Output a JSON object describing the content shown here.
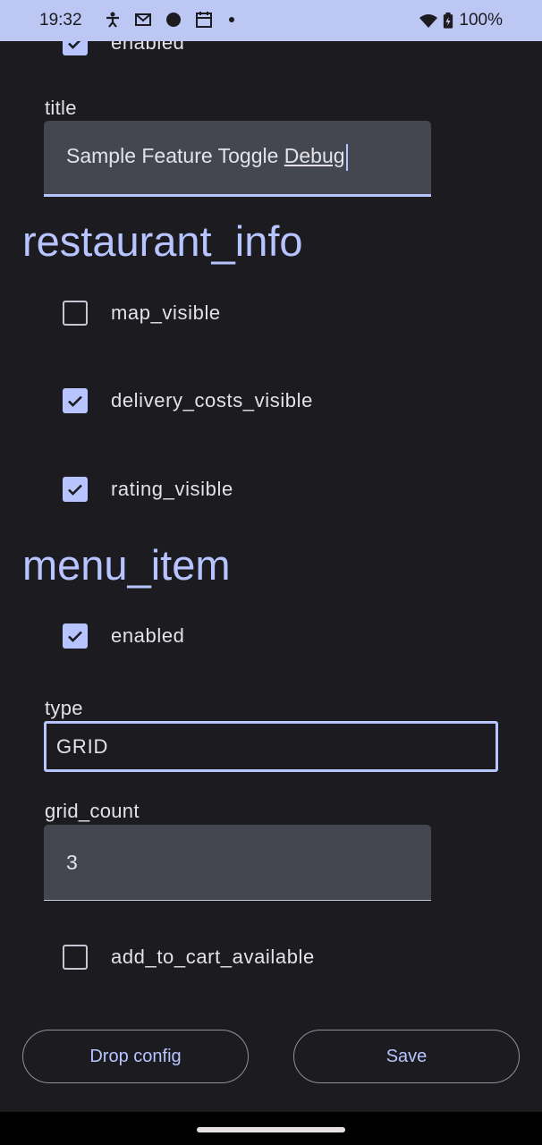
{
  "status_bar": {
    "time": "19:32",
    "battery": "100%",
    "left_icons": [
      "accessibility-icon",
      "gmail-icon",
      "app-notification-icon",
      "calendar-icon"
    ],
    "right_icons": [
      "wifi-icon",
      "battery-charging-icon"
    ]
  },
  "feature": {
    "enabled_label": "enabled",
    "enabled_checked": true,
    "title_label": "title",
    "title_value_plain": "Sample Feature Toggle ",
    "title_value_underlined": "Debug"
  },
  "restaurant_info": {
    "heading": "restaurant_info",
    "toggles": [
      {
        "label": "map_visible",
        "checked": false
      },
      {
        "label": "delivery_costs_visible",
        "checked": true
      },
      {
        "label": "rating_visible",
        "checked": true
      }
    ]
  },
  "menu_item": {
    "heading": "menu_item",
    "enabled_label": "enabled",
    "enabled_checked": true,
    "type_label": "type",
    "type_value": "GRID",
    "grid_count_label": "grid_count",
    "grid_count_value": "3",
    "add_to_cart_label": "add_to_cart_available",
    "add_to_cart_checked": false
  },
  "actions": {
    "drop_label": "Drop config",
    "save_label": "Save"
  },
  "colors": {
    "accent": "#b8c4ff",
    "background": "#1b1b20",
    "status_bar": "#bcc7f4"
  }
}
